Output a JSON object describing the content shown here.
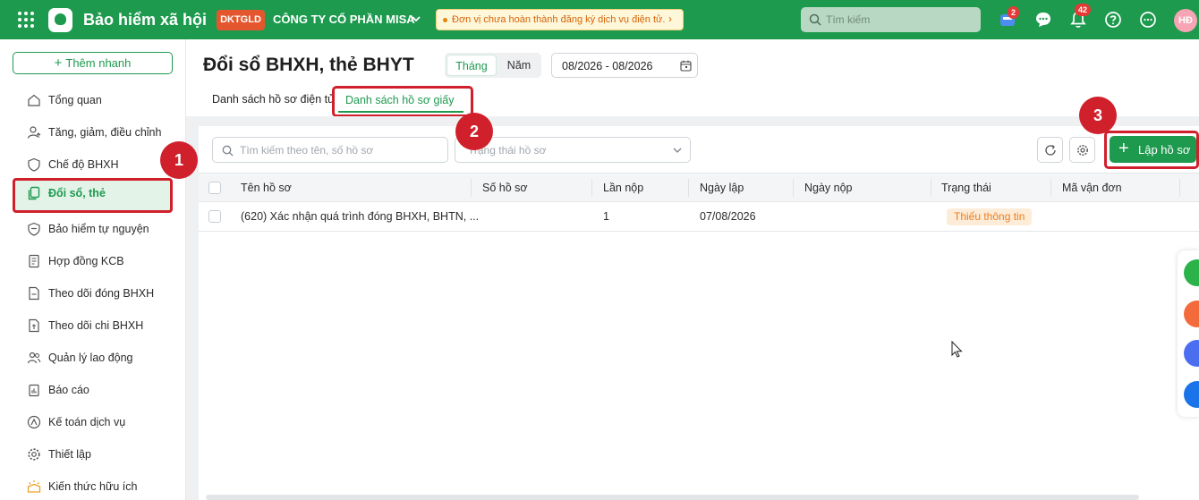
{
  "app": {
    "title": "Bảo hiểm xã hội",
    "company_badge": "DKTGLD",
    "company_name": "CÔNG TY CỔ PHẦN MISA",
    "notice": "Đơn vị chưa hoàn thành đăng ký dịch vụ điện tử.",
    "search_placeholder": "Tìm kiếm",
    "cart_count": "2",
    "notification_count": "42",
    "avatar_initials": "HĐ"
  },
  "sidebar": {
    "quick_add": "Thêm nhanh",
    "items": [
      {
        "label": "Tổng quan",
        "icon": "home-icon"
      },
      {
        "label": "Tăng, giảm, điều chỉnh",
        "icon": "user-adjust-icon"
      },
      {
        "label": "Chế độ BHXH",
        "icon": "shield-icon"
      },
      {
        "label": "Đổi sổ, thẻ",
        "icon": "copy-card-icon",
        "active": true
      },
      {
        "label": "Bảo hiểm tự nguyện",
        "icon": "shield-heart-icon"
      },
      {
        "label": "Hợp đồng KCB",
        "icon": "contract-icon"
      },
      {
        "label": "Theo dõi đóng BHXH",
        "icon": "payment-tracking-icon"
      },
      {
        "label": "Theo dõi chi BHXH",
        "icon": "expense-tracking-icon"
      },
      {
        "label": "Quản lý lao động",
        "icon": "users-icon"
      },
      {
        "label": "Báo cáo",
        "icon": "report-icon"
      },
      {
        "label": "Kế toán dịch vụ",
        "icon": "accounting-icon"
      },
      {
        "label": "Thiết lập",
        "icon": "gear-icon"
      },
      {
        "label": "Kiến thức hữu ích",
        "icon": "knowledge-icon"
      }
    ]
  },
  "header": {
    "title": "Đổi sổ BHXH, thẻ BHYT",
    "period_options": [
      "Tháng",
      "Năm"
    ],
    "period_selected": "Tháng",
    "date_range": "08/2026 - 08/2026"
  },
  "tabs": [
    {
      "label": "Danh sách hồ sơ điện tử"
    },
    {
      "label": "Danh sách hồ sơ giấy",
      "active": true
    }
  ],
  "filters": {
    "search_placeholder": "Tìm kiếm theo tên, số hồ sơ",
    "status_placeholder": "Trạng thái hồ sơ"
  },
  "actions": {
    "add_label": "Lập hồ sơ"
  },
  "table": {
    "columns": [
      "Tên hồ sơ",
      "Số hồ sơ",
      "Lần nộp",
      "Ngày lập",
      "Ngày nộp",
      "Trạng thái",
      "Mã vận đơn"
    ],
    "rows": [
      {
        "name": "(620) Xác nhận quá trình đóng BHXH, BHTN, ...",
        "number": "",
        "submission": "1",
        "created": "07/08/2026",
        "submitted": "",
        "status": "Thiếu thông tin",
        "tracking": ""
      }
    ]
  },
  "annotations": [
    "1",
    "2",
    "3"
  ],
  "colors": {
    "brand_green": "#1e9a4f",
    "annotation_red": "#d0202c",
    "status_orange": "#ee7d1c"
  }
}
